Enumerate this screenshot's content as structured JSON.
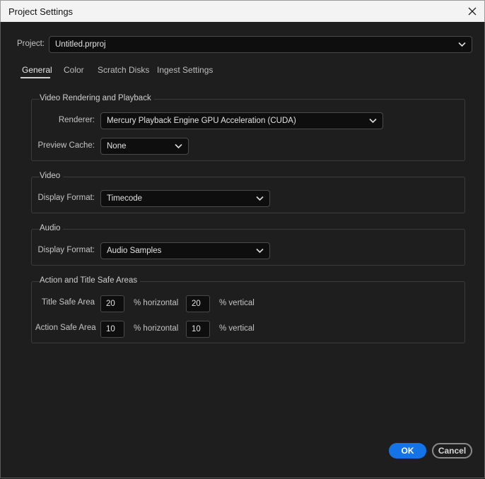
{
  "window": {
    "title": "Project Settings"
  },
  "project": {
    "label": "Project:",
    "value": "Untitled.prproj"
  },
  "tabs": [
    {
      "label": "General",
      "active": true
    },
    {
      "label": "Color",
      "active": false
    },
    {
      "label": "Scratch Disks",
      "active": false
    },
    {
      "label": "Ingest Settings",
      "active": false
    }
  ],
  "rendering": {
    "title": "Video Rendering and Playback",
    "renderer_label": "Renderer:",
    "renderer_value": "Mercury Playback Engine GPU Acceleration (CUDA)",
    "cache_label": "Preview Cache:",
    "cache_value": "None"
  },
  "video": {
    "title": "Video",
    "format_label": "Display Format:",
    "format_value": "Timecode"
  },
  "audio": {
    "title": "Audio",
    "format_label": "Display Format:",
    "format_value": "Audio Samples"
  },
  "safe_areas": {
    "title": "Action and Title Safe Areas",
    "title_safe_label": "Title Safe Area",
    "title_safe_h": "20",
    "title_safe_v": "20",
    "action_safe_label": "Action Safe Area",
    "action_safe_h": "10",
    "action_safe_v": "10",
    "horizontal_label": "% horizontal",
    "vertical_label": "% vertical"
  },
  "buttons": {
    "ok": "OK",
    "cancel": "Cancel"
  },
  "colors": {
    "accent": "#1473e6",
    "background": "#1e1e1e",
    "field": "#0e0e0e"
  },
  "icons": {
    "close": "close-icon",
    "dropdown": "chevron-down-icon"
  }
}
